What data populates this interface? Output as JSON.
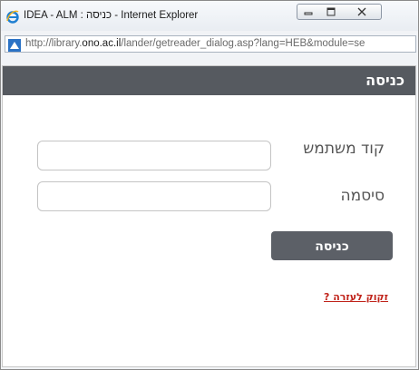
{
  "window": {
    "title": "IDEA - ALM : כניסה - Internet Explorer"
  },
  "address_bar": {
    "url_prefix": "http://library.",
    "url_domain": "ono.ac.il",
    "url_suffix": "/lander/getreader_dialog.asp?lang=HEB&module=se"
  },
  "dialog": {
    "title": "כניסה",
    "username_label": "קוד משתמש",
    "username_value": "",
    "password_label": "סיסמה",
    "password_value": "",
    "login_button": "כניסה",
    "help_link": "זקוק לעזרה ?"
  },
  "colors": {
    "header_bg": "#565a60",
    "button_bg": "#5c6067",
    "link": "#c0231a"
  },
  "icons": {
    "browser": "internet-explorer-icon",
    "page": "page-icon",
    "minimize": "minimize-icon",
    "maximize": "maximize-icon",
    "close": "close-icon"
  }
}
